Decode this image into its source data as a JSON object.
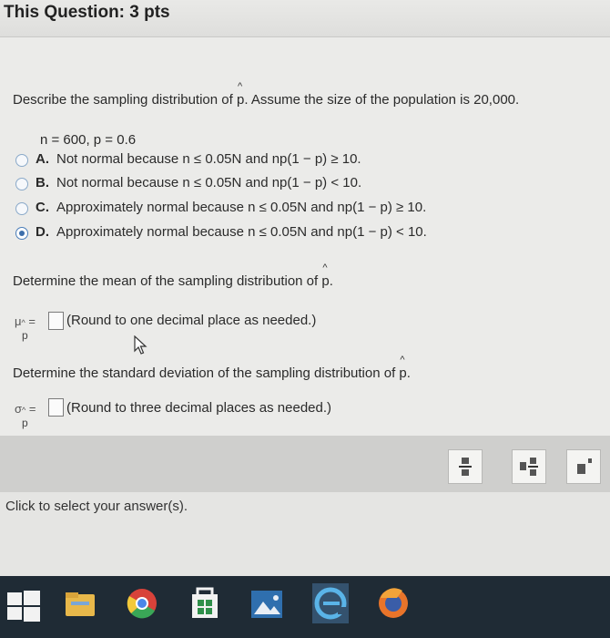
{
  "header": {
    "title": "This Question: 3 pts"
  },
  "question": {
    "prompt_prefix": "Describe the sampling distribution of",
    "p_hat": "p",
    "prompt_suffix": ". Assume the size of the population is 20,000.",
    "given": "n = 600, p = 0.6",
    "options": [
      {
        "letter": "A.",
        "text": "Not normal because n ≤ 0.05N and np(1 − p) ≥ 10.",
        "selected": false
      },
      {
        "letter": "B.",
        "text": "Not normal because n ≤ 0.05N and np(1 − p) < 10.",
        "selected": false
      },
      {
        "letter": "C.",
        "text": "Approximately normal because n ≤ 0.05N and np(1 − p) ≥ 10.",
        "selected": false
      },
      {
        "letter": "D.",
        "text": "Approximately normal because n ≤ 0.05N and np(1 − p) < 10.",
        "selected": true
      }
    ]
  },
  "mean_part": {
    "prompt": "Determine the mean of the sampling distribution of",
    "p_hat": "p",
    "end": ".",
    "symbol": "μ",
    "sub": "p",
    "equals": "=",
    "hint": "(Round to one decimal place as needed.)"
  },
  "sd_part": {
    "prompt": "Determine the standard deviation of the sampling distribution of",
    "p_hat": "p",
    "end": ".",
    "symbol": "σ",
    "sub": "p",
    "equals": "=",
    "hint": "(Round to three decimal places as needed.)"
  },
  "footer": {
    "status": "Click to select your answer(s)."
  },
  "colors": {
    "radio_selected": "#3d6fab",
    "taskbar": "#1f2b35"
  },
  "toolbar_icons": [
    "fraction-icon",
    "mixed-number-icon",
    "exponent-icon"
  ],
  "taskbar_icons": [
    "windows-start-icon",
    "file-explorer-icon",
    "chrome-icon",
    "store-icon",
    "photos-icon",
    "edge-icon",
    "firefox-icon"
  ]
}
